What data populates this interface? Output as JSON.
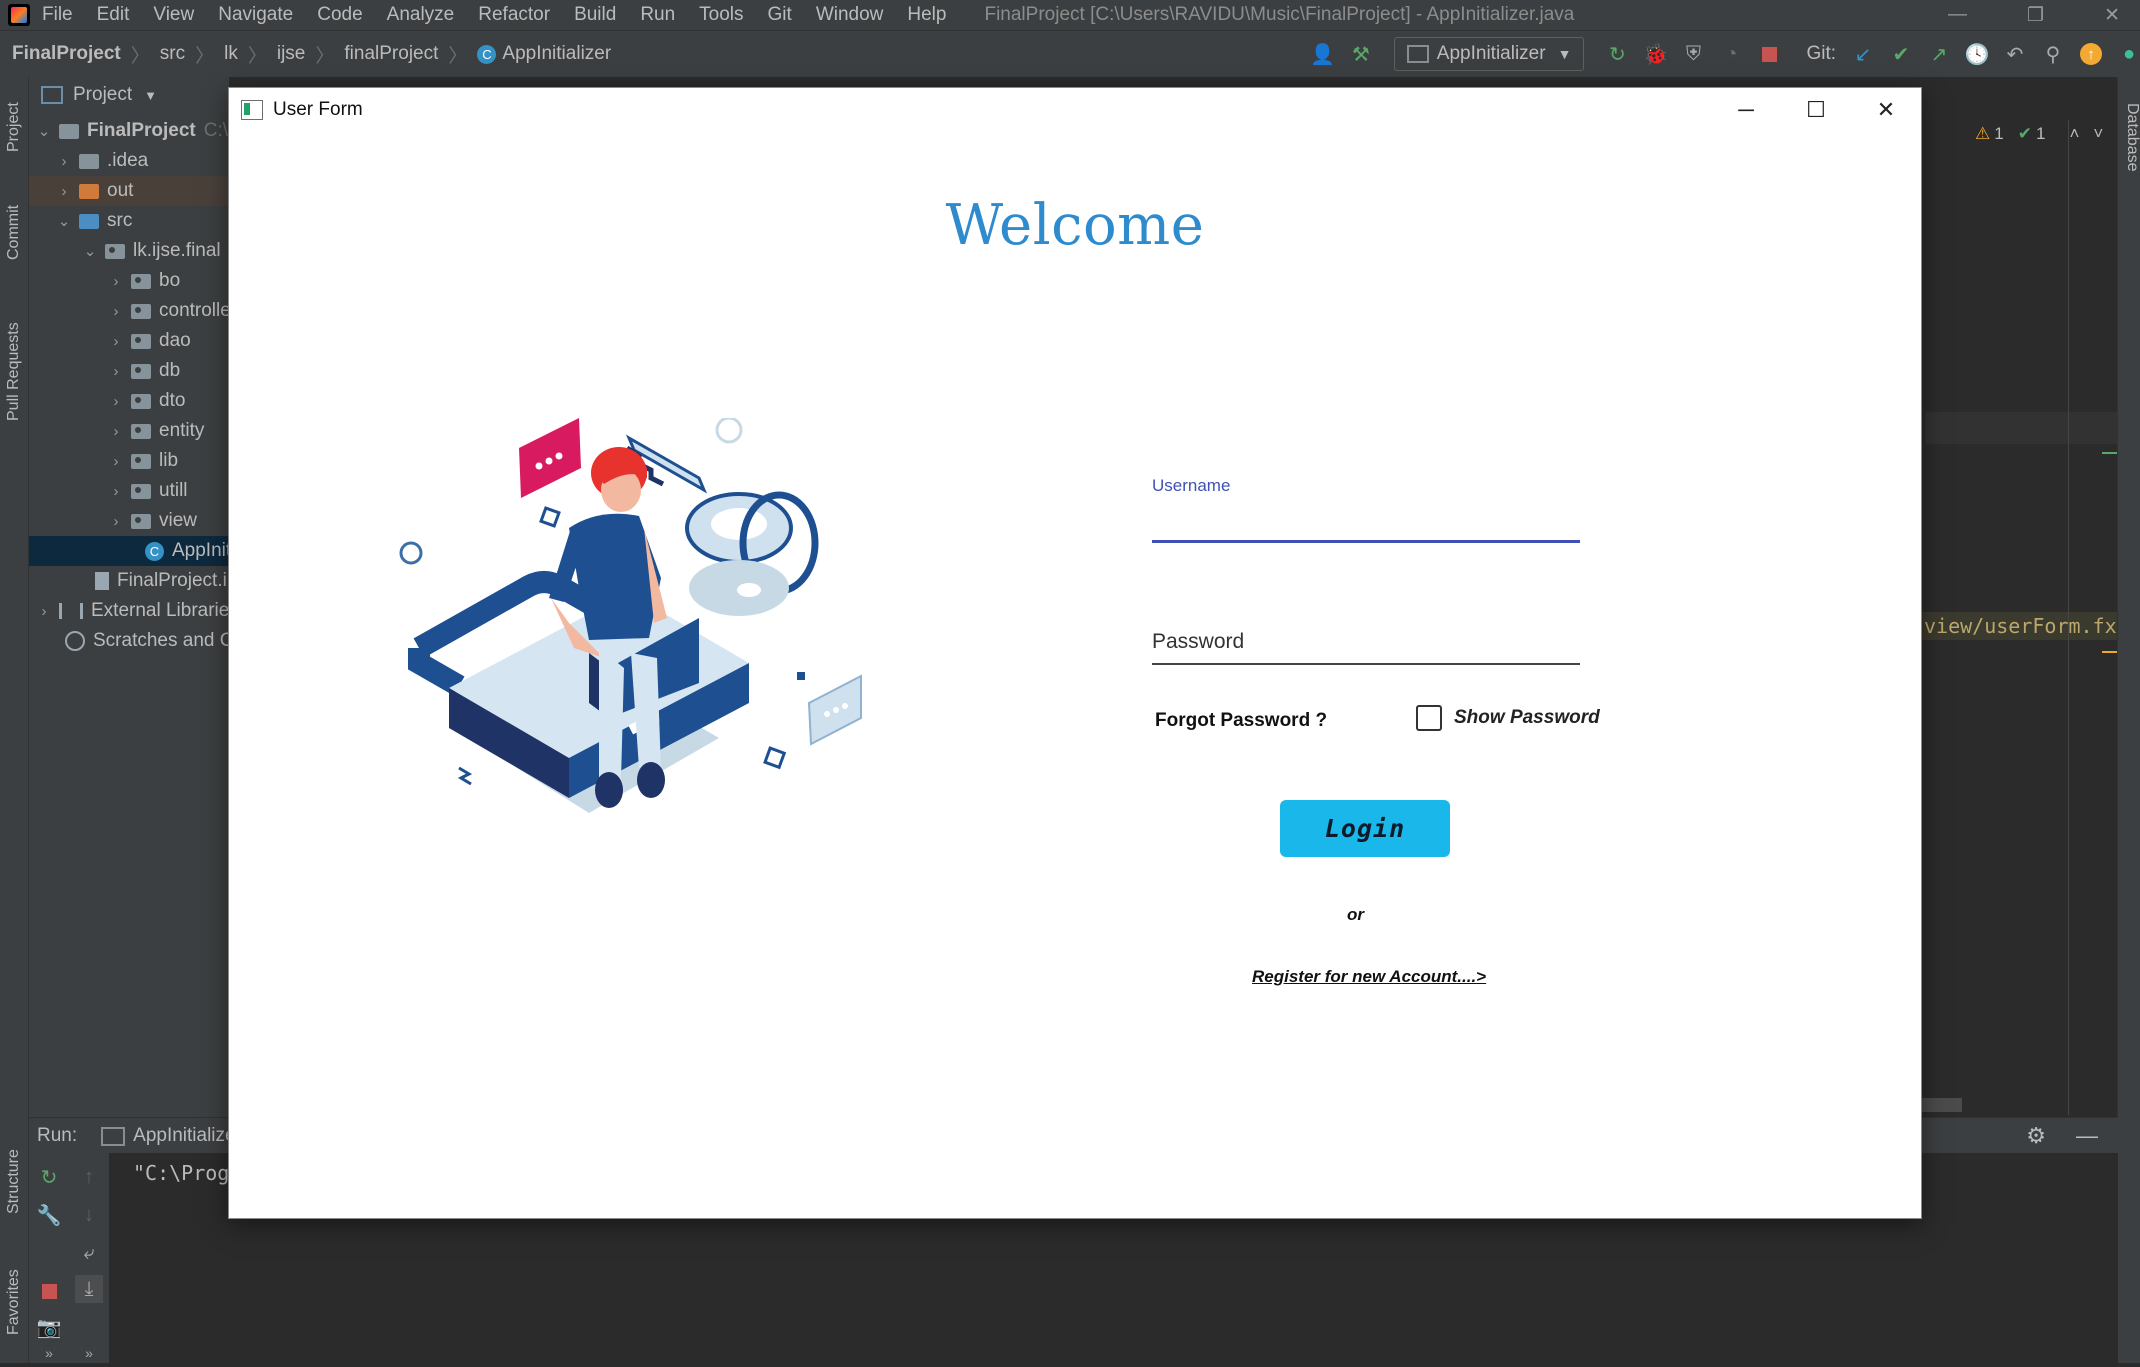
{
  "ide": {
    "menu": [
      "File",
      "Edit",
      "View",
      "Navigate",
      "Code",
      "Analyze",
      "Refactor",
      "Build",
      "Run",
      "Tools",
      "Git",
      "Window",
      "Help"
    ],
    "window_title": "FinalProject [C:\\Users\\RAVIDU\\Music\\FinalProject] - AppInitializer.java",
    "breadcrumb": [
      "FinalProject",
      "src",
      "lk",
      "ijse",
      "finalProject",
      "AppInitializer"
    ],
    "run_config": "AppInitializer",
    "git_label": "Git:",
    "left_tabs": {
      "project": "Project",
      "commit": "Commit",
      "pull_requests": "Pull Requests",
      "structure": "Structure",
      "favorites": "Favorites"
    },
    "right_tab": "Database",
    "project_panel": {
      "title": "Project",
      "tree": [
        {
          "label": "FinalProject",
          "suffix": "C:\\",
          "depth": 0,
          "expanded": true,
          "bold": true,
          "icon": "module-icon"
        },
        {
          "label": ".idea",
          "depth": 1,
          "expanded": false,
          "icon": "folder-icon"
        },
        {
          "label": "out",
          "depth": 1,
          "expanded": false,
          "icon": "folder-orange-icon"
        },
        {
          "label": "src",
          "depth": 1,
          "expanded": true,
          "icon": "folder-blue-icon"
        },
        {
          "label": "lk.ijse.final",
          "depth": 2,
          "expanded": true,
          "icon": "package-icon"
        },
        {
          "label": "bo",
          "depth": 3,
          "expanded": false,
          "icon": "package-icon"
        },
        {
          "label": "controller",
          "depth": 3,
          "expanded": false,
          "icon": "package-icon"
        },
        {
          "label": "dao",
          "depth": 3,
          "expanded": false,
          "icon": "package-icon"
        },
        {
          "label": "db",
          "depth": 3,
          "expanded": false,
          "icon": "package-icon"
        },
        {
          "label": "dto",
          "depth": 3,
          "expanded": false,
          "icon": "package-icon"
        },
        {
          "label": "entity",
          "depth": 3,
          "expanded": false,
          "icon": "package-icon"
        },
        {
          "label": "lib",
          "depth": 3,
          "expanded": false,
          "icon": "package-icon"
        },
        {
          "label": "utill",
          "depth": 3,
          "expanded": false,
          "icon": "package-icon"
        },
        {
          "label": "view",
          "depth": 3,
          "expanded": false,
          "icon": "package-icon"
        },
        {
          "label": "AppInitializer",
          "depth": 3,
          "icon": "class-icon",
          "selected": true
        },
        {
          "label": "FinalProject.iml",
          "depth": 1,
          "icon": "file-icon"
        },
        {
          "label": "External Libraries",
          "depth": 0,
          "expanded": false,
          "icon": "library-icon"
        },
        {
          "label": "Scratches and Consoles",
          "depth": 0,
          "icon": "scratches-icon"
        }
      ]
    },
    "inspections": {
      "warnings": "1",
      "checks": "1"
    },
    "code_fragment": "view/userForm.fxm",
    "run_panel": {
      "label": "Run:",
      "tab": "AppInitializer",
      "console_line": "\"C:\\Prog"
    }
  },
  "dialog": {
    "title": "User Form",
    "heading": "Welcome",
    "username": {
      "label": "Username",
      "value": ""
    },
    "password": {
      "placeholder": "Password",
      "value": ""
    },
    "forgot_password": "Forgot Password ?",
    "show_password": {
      "label": "Show Password",
      "checked": false
    },
    "login_button": "Login",
    "or_text": "or",
    "register_link": "Register for new Account....>"
  },
  "colors": {
    "welcome": "#2e8bce",
    "accent_underline": "#3f51b5",
    "login_button": "#1ab8ea",
    "ide_background": "#2b2b2b",
    "ide_panel": "#3c3f41"
  }
}
